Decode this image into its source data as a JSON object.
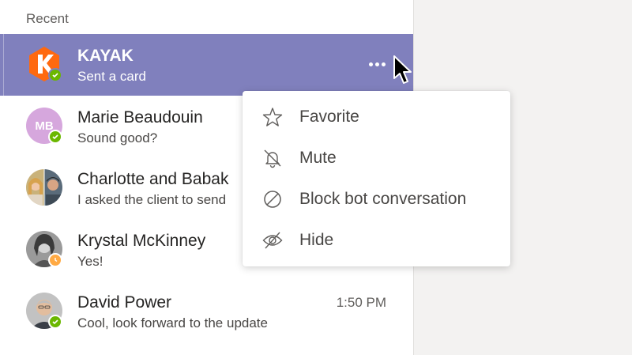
{
  "section_title": "Recent",
  "colors": {
    "selected_bg": "#8080bd",
    "available": "#6bb700",
    "away": "#ffaa44"
  },
  "chats": [
    {
      "name": "KAYAK",
      "preview": "Sent a card",
      "time": "",
      "status": "available",
      "avatar": "kayak-logo",
      "selected": true
    },
    {
      "name": "Marie Beaudouin",
      "preview": "Sound good?",
      "time": "",
      "status": "available",
      "avatar_initials": "MB"
    },
    {
      "name": "Charlotte and Babak",
      "preview": "I asked the client to send",
      "time": "",
      "status": "none",
      "avatar": "group-photo"
    },
    {
      "name": "Krystal McKinney",
      "preview": "Yes!",
      "time": "",
      "status": "away",
      "avatar": "photo"
    },
    {
      "name": "David Power",
      "preview": "Cool, look forward to the update",
      "time": "1:50 PM",
      "status": "available",
      "avatar": "photo"
    }
  ],
  "context_menu": {
    "items": [
      {
        "label": "Favorite",
        "icon": "star-icon"
      },
      {
        "label": "Mute",
        "icon": "bell-slash-icon"
      },
      {
        "label": "Block bot conversation",
        "icon": "block-icon"
      },
      {
        "label": "Hide",
        "icon": "eye-slash-icon"
      }
    ]
  }
}
